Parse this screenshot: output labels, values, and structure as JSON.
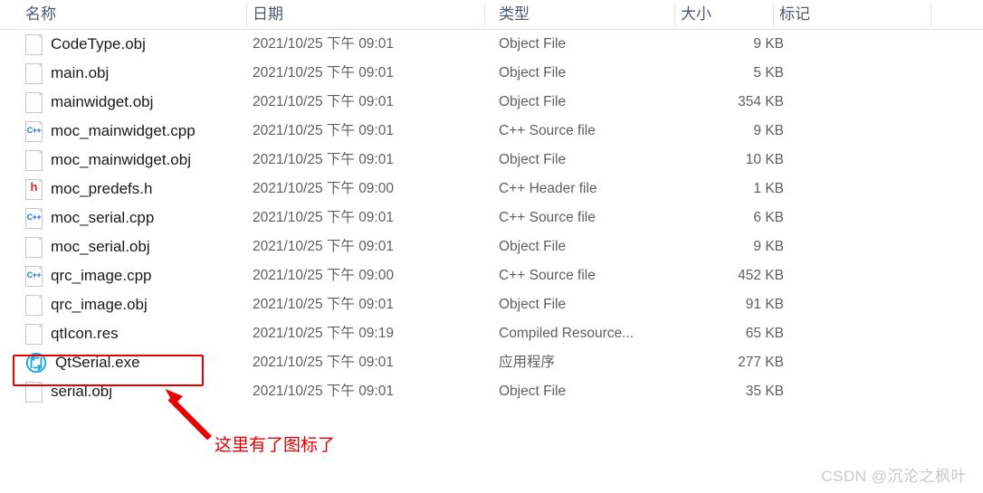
{
  "columns": [
    {
      "key": "name",
      "label": "名称"
    },
    {
      "key": "date",
      "label": "日期"
    },
    {
      "key": "type",
      "label": "类型"
    },
    {
      "key": "size",
      "label": "大小"
    },
    {
      "key": "tags",
      "label": "标记"
    }
  ],
  "files": [
    {
      "icon": "blank-file-icon",
      "name": "CodeType.obj",
      "date": "2021/10/25 下午 09:01",
      "type": "Object File",
      "size": "9 KB",
      "selected": false
    },
    {
      "icon": "blank-file-icon",
      "name": "main.obj",
      "date": "2021/10/25 下午 09:01",
      "type": "Object File",
      "size": "5 KB",
      "selected": false
    },
    {
      "icon": "blank-file-icon",
      "name": "mainwidget.obj",
      "date": "2021/10/25 下午 09:01",
      "type": "Object File",
      "size": "354 KB",
      "selected": false
    },
    {
      "icon": "cpp-source-icon",
      "name": "moc_mainwidget.cpp",
      "date": "2021/10/25 下午 09:01",
      "type": "C++ Source file",
      "size": "9 KB",
      "selected": false
    },
    {
      "icon": "blank-file-icon",
      "name": "moc_mainwidget.obj",
      "date": "2021/10/25 下午 09:01",
      "type": "Object File",
      "size": "10 KB",
      "selected": false
    },
    {
      "icon": "cpp-header-icon",
      "name": "moc_predefs.h",
      "date": "2021/10/25 下午 09:00",
      "type": "C++ Header file",
      "size": "1 KB",
      "selected": false
    },
    {
      "icon": "cpp-source-icon",
      "name": "moc_serial.cpp",
      "date": "2021/10/25 下午 09:01",
      "type": "C++ Source file",
      "size": "6 KB",
      "selected": false
    },
    {
      "icon": "blank-file-icon",
      "name": "moc_serial.obj",
      "date": "2021/10/25 下午 09:01",
      "type": "Object File",
      "size": "9 KB",
      "selected": false
    },
    {
      "icon": "cpp-source-icon",
      "name": "qrc_image.cpp",
      "date": "2021/10/25 下午 09:00",
      "type": "C++ Source file",
      "size": "452 KB",
      "selected": false
    },
    {
      "icon": "blank-file-icon",
      "name": "qrc_image.obj",
      "date": "2021/10/25 下午 09:01",
      "type": "Object File",
      "size": "91 KB",
      "selected": false
    },
    {
      "icon": "blank-file-icon",
      "name": "qtIcon.res",
      "date": "2021/10/25 下午 09:19",
      "type": "Compiled Resource...",
      "size": "65 KB",
      "selected": false
    },
    {
      "icon": "serial-app-icon",
      "name": "QtSerial.exe",
      "date": "2021/10/25 下午 09:01",
      "type": "应用程序",
      "size": "277 KB",
      "selected": true
    },
    {
      "icon": "blank-file-icon",
      "name": "serial.obj",
      "date": "2021/10/25 下午 09:01",
      "type": "Object File",
      "size": "35 KB",
      "selected": false
    }
  ],
  "annotation": {
    "text": "这里有了图标了",
    "highlight_target": "QtSerial.exe",
    "color": "#e60000"
  },
  "watermark": {
    "text": "CSDN @沉沦之枫叶",
    "color": "#c9c9c9"
  },
  "icon_glyphs": {
    "cpp-source-icon": "C++",
    "cpp-header-icon": "h"
  }
}
